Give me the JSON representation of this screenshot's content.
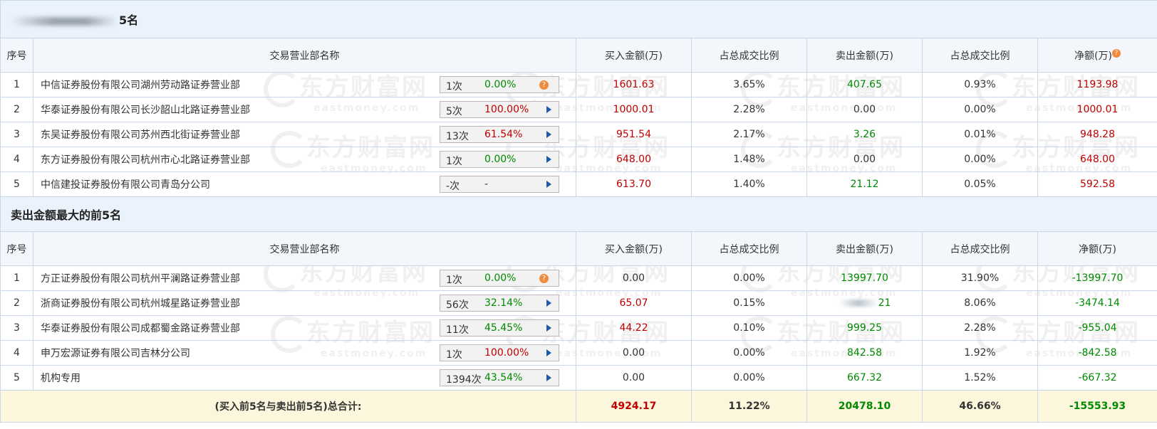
{
  "sections": {
    "buy_title_visible": "5名",
    "sell_title": "卖出金额最大的前5名"
  },
  "headers": {
    "index": "序号",
    "name": "交易营业部名称",
    "buy_amount": "买入金额(万)",
    "buy_ratio": "占总成交比例",
    "sell_amount": "卖出金额(万)",
    "sell_ratio": "占总成交比例",
    "net": "净额(万)"
  },
  "buy_rows": [
    {
      "index": "1",
      "name": "中信证券股份有限公司湖州劳动路证券营业部",
      "count": "1次",
      "pct": "0.00%",
      "pct_color": "green",
      "action": "question",
      "buy": "1601.63",
      "buy_color": "red",
      "buy_ratio": "3.65%",
      "sell": "407.65",
      "sell_color": "green",
      "sell_ratio": "0.93%",
      "net": "1193.98",
      "net_color": "red"
    },
    {
      "index": "2",
      "name": "华泰证券股份有限公司长沙韶山北路证券营业部",
      "count": "5次",
      "pct": "100.00%",
      "pct_color": "red",
      "action": "arrow",
      "buy": "1000.01",
      "buy_color": "red",
      "buy_ratio": "2.28%",
      "sell": "0.00",
      "sell_color": "black",
      "sell_ratio": "0.00%",
      "net": "1000.01",
      "net_color": "red"
    },
    {
      "index": "3",
      "name": "东吴证券股份有限公司苏州西北街证券营业部",
      "count": "13次",
      "pct": "61.54%",
      "pct_color": "red",
      "action": "arrow",
      "buy": "951.54",
      "buy_color": "red",
      "buy_ratio": "2.17%",
      "sell": "3.26",
      "sell_color": "green",
      "sell_ratio": "0.01%",
      "net": "948.28",
      "net_color": "red"
    },
    {
      "index": "4",
      "name": "东方证券股份有限公司杭州市心北路证券营业部",
      "count": "1次",
      "pct": "0.00%",
      "pct_color": "green",
      "action": "arrow",
      "buy": "648.00",
      "buy_color": "red",
      "buy_ratio": "1.48%",
      "sell": "0.00",
      "sell_color": "black",
      "sell_ratio": "0.00%",
      "net": "648.00",
      "net_color": "red"
    },
    {
      "index": "5",
      "name": "中信建投证券股份有限公司青岛分公司",
      "count": "-次",
      "pct": "-",
      "pct_color": "black",
      "action": "arrow",
      "buy": "613.70",
      "buy_color": "red",
      "buy_ratio": "1.40%",
      "sell": "21.12",
      "sell_color": "green",
      "sell_ratio": "0.05%",
      "net": "592.58",
      "net_color": "red"
    }
  ],
  "sell_rows": [
    {
      "index": "1",
      "name": "方正证券股份有限公司杭州平澜路证券营业部",
      "count": "1次",
      "pct": "0.00%",
      "pct_color": "green",
      "action": "question",
      "buy": "0.00",
      "buy_color": "black",
      "buy_ratio": "0.00%",
      "sell": "13997.70",
      "sell_color": "green",
      "sell_ratio": "31.90%",
      "net": "-13997.70",
      "net_color": "green"
    },
    {
      "index": "2",
      "name": "浙商证券股份有限公司杭州城星路证券营业部",
      "count": "56次",
      "pct": "32.14%",
      "pct_color": "green",
      "action": "arrow",
      "buy": "65.07",
      "buy_color": "red",
      "buy_ratio": "0.15%",
      "sell": "21",
      "sell_color": "green",
      "sell_ratio": "8.06%",
      "net": "-3474.14",
      "net_color": "green"
    },
    {
      "index": "3",
      "name": "华泰证券股份有限公司成都蜀金路证券营业部",
      "count": "11次",
      "pct": "45.45%",
      "pct_color": "green",
      "action": "arrow",
      "buy": "44.22",
      "buy_color": "red",
      "buy_ratio": "0.10%",
      "sell": "999.25",
      "sell_color": "green",
      "sell_ratio": "2.28%",
      "net": "-955.04",
      "net_color": "green"
    },
    {
      "index": "4",
      "name": "申万宏源证券有限公司吉林分公司",
      "count": "1次",
      "pct": "100.00%",
      "pct_color": "red",
      "action": "arrow",
      "buy": "0.00",
      "buy_color": "black",
      "buy_ratio": "0.00%",
      "sell": "842.58",
      "sell_color": "green",
      "sell_ratio": "1.92%",
      "net": "-842.58",
      "net_color": "green"
    },
    {
      "index": "5",
      "name": "机构专用",
      "count": "1394次",
      "pct": "43.54%",
      "pct_color": "green",
      "action": "arrow",
      "buy": "0.00",
      "buy_color": "black",
      "buy_ratio": "0.00%",
      "sell": "667.32",
      "sell_color": "green",
      "sell_ratio": "1.52%",
      "net": "-667.32",
      "net_color": "green"
    }
  ],
  "total": {
    "label": "(买入前5名与卖出前5名)总合计:",
    "buy": "4924.17",
    "buy_ratio": "11.22%",
    "sell": "20478.10",
    "sell_ratio": "46.66%",
    "net": "-15553.93"
  },
  "watermark": {
    "text": "东方财富网",
    "domain": "eastmoney.com"
  },
  "colors": {
    "red": "#c00000",
    "green": "#008a00",
    "header_bg": "#eaf2fb",
    "total_bg": "#fbf6dc",
    "border": "#c9d7e8"
  }
}
